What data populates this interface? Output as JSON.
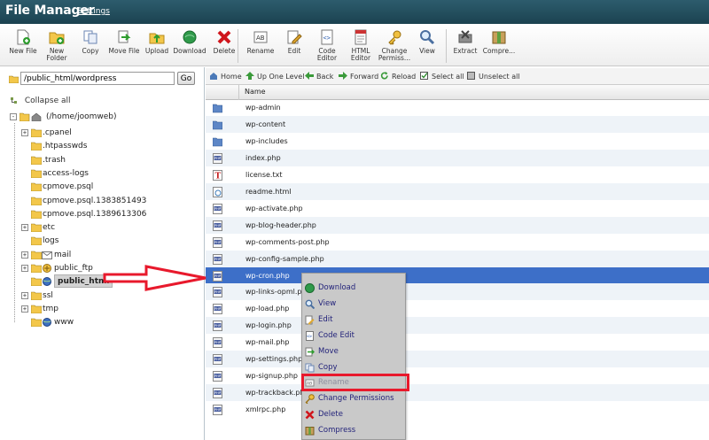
{
  "header": {
    "title": "File Manager",
    "settings_label": "Settings"
  },
  "toolbar": {
    "new_file": "New File",
    "new_folder_1": "New",
    "new_folder_2": "Folder",
    "copy": "Copy",
    "move_file": "Move File",
    "upload": "Upload",
    "download": "Download",
    "delete": "Delete",
    "rename": "Rename",
    "edit": "Edit",
    "code_editor_1": "Code",
    "code_editor_2": "Editor",
    "html_editor_1": "HTML",
    "html_editor_2": "Editor",
    "change_perms_1": "Change",
    "change_perms_2": "Permiss...",
    "view": "View",
    "extract": "Extract",
    "compress": "Compre..."
  },
  "path": {
    "value": "/public_html/wordpress",
    "go_label": "Go"
  },
  "tree": {
    "collapse_all": "Collapse all",
    "root": "(/home/joomweb)",
    "items": [
      ".cpanel",
      ".htpasswds",
      ".trash",
      "access-logs",
      "cpmove.psql",
      "cpmove.psql.1383851493",
      "cpmove.psql.1389613306",
      "etc",
      "logs",
      "mail",
      "public_ftp",
      "public_html",
      "ssl",
      "tmp",
      "www"
    ]
  },
  "nav": {
    "home": "Home",
    "up": "Up One Level",
    "back": "Back",
    "forward": "Forward",
    "reload": "Reload",
    "select_all": "Select all",
    "unselect_all": "Unselect all"
  },
  "table": {
    "name_header": "Name",
    "files": [
      "wp-admin",
      "wp-content",
      "wp-includes",
      "index.php",
      "license.txt",
      "readme.html",
      "wp-activate.php",
      "wp-blog-header.php",
      "wp-comments-post.php",
      "wp-config-sample.php",
      "wp-cron.php",
      "wp-links-opml.php",
      "wp-load.php",
      "wp-login.php",
      "wp-mail.php",
      "wp-settings.php",
      "wp-signup.php",
      "wp-trackback.php",
      "xmlrpc.php"
    ]
  },
  "context_menu": {
    "items": [
      "Download",
      "View",
      "Edit",
      "Code Edit",
      "Move",
      "Copy",
      "Rename",
      "Change Permissions",
      "Delete",
      "Compress"
    ]
  },
  "colors": {
    "header": "#24505f",
    "selection": "#3d6fc8",
    "annotation": "#e8192c"
  }
}
